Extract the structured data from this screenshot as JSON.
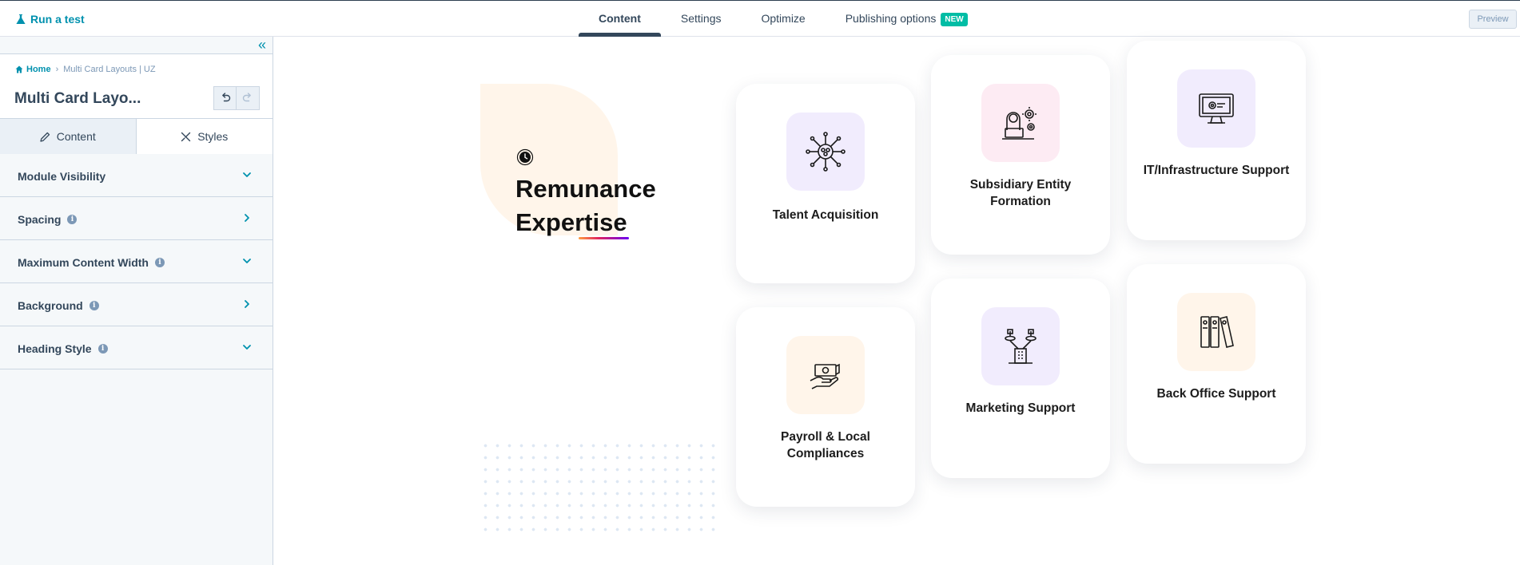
{
  "topbar": {
    "run_test": "Run a test",
    "tabs": [
      {
        "label": "Content",
        "active": true
      },
      {
        "label": "Settings"
      },
      {
        "label": "Optimize"
      },
      {
        "label": "Publishing options",
        "badge": "NEW"
      }
    ],
    "preview": "Preview"
  },
  "sidebar": {
    "breadcrumb": {
      "home": "Home",
      "current": "Multi Card Layouts | UZ"
    },
    "title": "Multi Card Layo...",
    "tabs": {
      "content": "Content",
      "styles": "Styles"
    },
    "sections": [
      {
        "label": "Module Visibility",
        "info": false,
        "chevron": "down"
      },
      {
        "label": "Spacing",
        "info": true,
        "chevron": "right"
      },
      {
        "label": "Maximum Content Width",
        "info": true,
        "chevron": "down"
      },
      {
        "label": "Background",
        "info": true,
        "chevron": "right"
      },
      {
        "label": "Heading Style",
        "info": true,
        "chevron": "down"
      }
    ]
  },
  "canvas": {
    "heading_line1": "Remunance",
    "heading_line2": "Expertise",
    "cards": [
      {
        "title": "Talent Acquisition",
        "icon": "network-people-icon",
        "bg": "#f1ecfd"
      },
      {
        "title": "Subsidiary Entity Formation",
        "icon": "laptop-gears-icon",
        "bg": "#fdebf3"
      },
      {
        "title": "IT/Infrastructure Support",
        "icon": "monitor-gear-icon",
        "bg": "#f1ecfd"
      },
      {
        "title": "Payroll & Local Compliances",
        "icon": "hand-cash-icon",
        "bg": "#fff5ea"
      },
      {
        "title": "Marketing Support",
        "icon": "buildings-network-icon",
        "bg": "#f1ecfd"
      },
      {
        "title": "Back Office Support",
        "icon": "binders-icon",
        "bg": "#fff5ea"
      }
    ]
  },
  "colors": {
    "accent": "#0091ae",
    "text": "#33475b",
    "badge": "#00bda5",
    "sidebar_bg": "#f5f8fa"
  }
}
